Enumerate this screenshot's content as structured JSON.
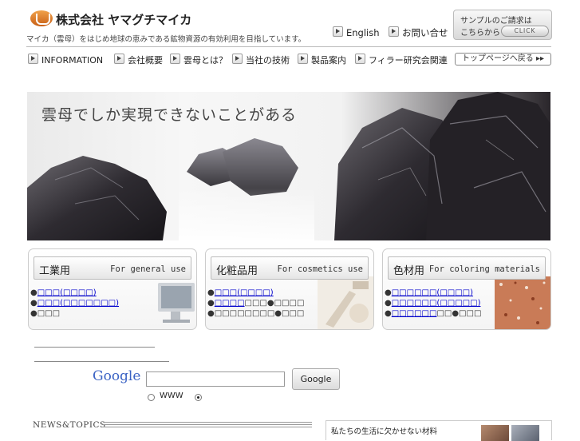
{
  "header": {
    "company_name": "株式会社 ヤマグチマイカ",
    "tagline": "マイカ（雲母）をはじめ地球の恵みである鉱物資源の有効利用を目指しています。",
    "links": [
      {
        "label": "English"
      },
      {
        "label": "お問い合せ"
      }
    ],
    "sample_box": {
      "line1": "サンプルのご請求は",
      "line2": "こちらから",
      "click_label": "CLICK"
    }
  },
  "nav": {
    "items": [
      {
        "label": "INFORMATION"
      },
      {
        "label": "会社概要"
      },
      {
        "label": "雲母とは？"
      },
      {
        "label": "当社の技術"
      },
      {
        "label": "製品案内"
      },
      {
        "label": "フィラー研究会関連"
      }
    ],
    "back_to_top": "トップページへ戻る ▸▸"
  },
  "hero": {
    "title": "雲母でしか実現できないことがある"
  },
  "panels": [
    {
      "title_jp": "工業用",
      "title_en": "For general use",
      "lines": [
        [
          {
            "t": "●"
          },
          {
            "t": "□□□(□□□□)",
            "link": true
          }
        ],
        [
          {
            "t": "●"
          },
          {
            "t": "□□□(□□□□□□□)",
            "link": true
          }
        ],
        [
          {
            "t": "●□□□"
          }
        ]
      ]
    },
    {
      "title_jp": "化粧品用",
      "title_en": "For cosmetics use",
      "lines": [
        [
          {
            "t": "●"
          },
          {
            "t": "□□□(□□□□)",
            "link": true
          }
        ],
        [
          {
            "t": "●"
          },
          {
            "t": "□□□□",
            "link": true
          },
          {
            "t": "□□□●□□□□"
          }
        ],
        [
          {
            "t": "●□□□□□□□□●□□□"
          }
        ]
      ]
    },
    {
      "title_jp": "色材用",
      "title_en": "For coloring materials",
      "lines": [
        [
          {
            "t": "●"
          },
          {
            "t": "□□□□□□(□□□□)",
            "link": true
          }
        ],
        [
          {
            "t": "●"
          },
          {
            "t": "□□□□□□(□□□□□)",
            "link": true
          }
        ],
        [
          {
            "t": "●"
          },
          {
            "t": "□□□□□□",
            "link": true
          },
          {
            "t": "□□●□□□"
          }
        ]
      ]
    }
  ],
  "search": {
    "logo_text": "Google",
    "input_value": "",
    "button_label": "Google",
    "radio_options": [
      {
        "label": "WWW",
        "checked": false
      },
      {
        "label": "",
        "checked": true
      }
    ]
  },
  "news": {
    "heading": "NEWS&TOPICS",
    "side_text": "私たちの生活に欠かせない材料"
  },
  "colors": {
    "accent_orange": "#d9772a",
    "link_blue": "#0000cc",
    "hero_dark": "#2a262b"
  }
}
